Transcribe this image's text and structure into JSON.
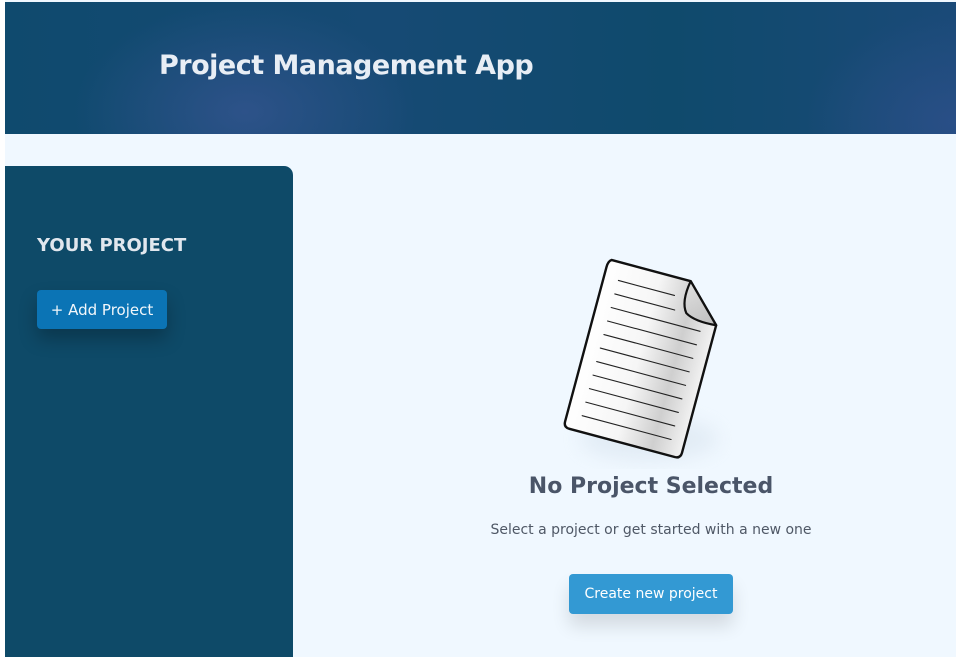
{
  "header": {
    "title": "Project Management App"
  },
  "sidebar": {
    "heading": "YOUR PROJECT",
    "add_button_label": "+ Add Project"
  },
  "main": {
    "empty_state": {
      "icon": "document-icon",
      "title": "No Project Selected",
      "description": "Select a project or get started with a new one",
      "create_button_label": "Create new project"
    }
  },
  "colors": {
    "header_bg": "#0f4a6e",
    "sidebar_bg": "#0e4a68",
    "main_bg": "#f0f8ff",
    "add_button": "#0b74b5",
    "create_button": "#3399d3",
    "heading_text": "#4a5568"
  }
}
